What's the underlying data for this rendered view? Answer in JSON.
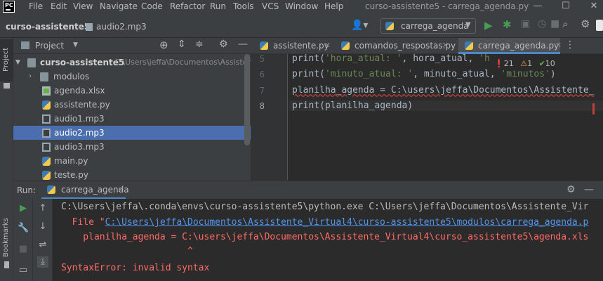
{
  "app": {
    "logo_text": "PC",
    "window_title": "curso-assistente5 - carrega_agenda.py"
  },
  "menu": [
    "File",
    "Edit",
    "View",
    "Navigate",
    "Code",
    "Refactor",
    "Run",
    "Tools",
    "VCS",
    "Window",
    "Help"
  ],
  "window_controls": {
    "minimize": "—",
    "maximize": "☐",
    "close": "✕"
  },
  "navbar": {
    "project": "curso-assistente5",
    "file": "audio2.mp3",
    "run_config": "carrega_agenda"
  },
  "left_strip": {
    "project_label": "Project",
    "bookmarks_label": "Bookmarks"
  },
  "project_panel": {
    "title": "Project",
    "root": {
      "name": "curso-assistente5",
      "path": "C:\\Users\\jeffa\\Documentos\\Assistente"
    },
    "items": [
      {
        "name": "modulos",
        "type": "folder"
      },
      {
        "name": "agenda.xlsx",
        "type": "xlsx"
      },
      {
        "name": "assistente.py",
        "type": "py"
      },
      {
        "name": "audio1.mp3",
        "type": "mp3"
      },
      {
        "name": "audio2.mp3",
        "type": "mp3",
        "selected": true
      },
      {
        "name": "audio3.mp3",
        "type": "mp3"
      },
      {
        "name": "main.py",
        "type": "py"
      },
      {
        "name": "teste.py",
        "type": "py"
      }
    ]
  },
  "editor": {
    "tabs": [
      {
        "label": "assistente.py"
      },
      {
        "label": "comandos_respostas.py"
      },
      {
        "label": "carrega_agenda.py",
        "active": true
      }
    ],
    "inspections": {
      "errors": "21",
      "warnings": "1",
      "weak": "10"
    },
    "lines": [
      {
        "no": "5",
        "pre": "print(",
        "s1": "'hora_atual: '",
        "mid": ", hora_atual, ",
        "s2": "'h",
        "post": ""
      },
      {
        "no": "6",
        "pre": "print(",
        "s1": "'minuto_atual: '",
        "mid": ", minuto_atual, ",
        "s2": "'minutos'",
        "post": ")"
      },
      {
        "no": "7",
        "pre": "planilha_agenda = C:\\users\\jeffa\\Documentos\\Assistente_",
        "s1": "",
        "mid": "",
        "s2": "",
        "post": ""
      },
      {
        "no": "8",
        "pre": "print(planilha_agenda)",
        "s1": "",
        "mid": "",
        "s2": "",
        "post": ""
      }
    ]
  },
  "run_panel": {
    "label": "Run:",
    "config": "carrega_agenda",
    "console": [
      {
        "text": "C:\\Users\\jeffa\\.conda\\envs\\curso-assistente5\\python.exe C:\\Users\\jeffa\\Documentos\\Assistente_Vir",
        "color": "#bbbbbb"
      },
      {
        "text": "  File \"",
        "link": "C:\\Users\\jeffa\\Documentos\\Assistente_Virtual4\\curso-assistente5\\modulos\\carrega_agenda.p",
        "color": "#ff6b68"
      },
      {
        "text": "    planilha_agenda = C:\\users\\jeffa\\Documentos\\Assistente_Virtual4\\curso_assistente5\\agenda.xls",
        "color": "#ff6b68"
      },
      {
        "text": "                       ^",
        "color": "#ff6b68"
      },
      {
        "text": "SyntaxError: invalid syntax",
        "color": "#ff6b68"
      }
    ]
  },
  "colors": {
    "accent": "#4a88c7",
    "selection": "#4b6eaf",
    "error": "#ff6b68",
    "run_green": "#499c54"
  }
}
